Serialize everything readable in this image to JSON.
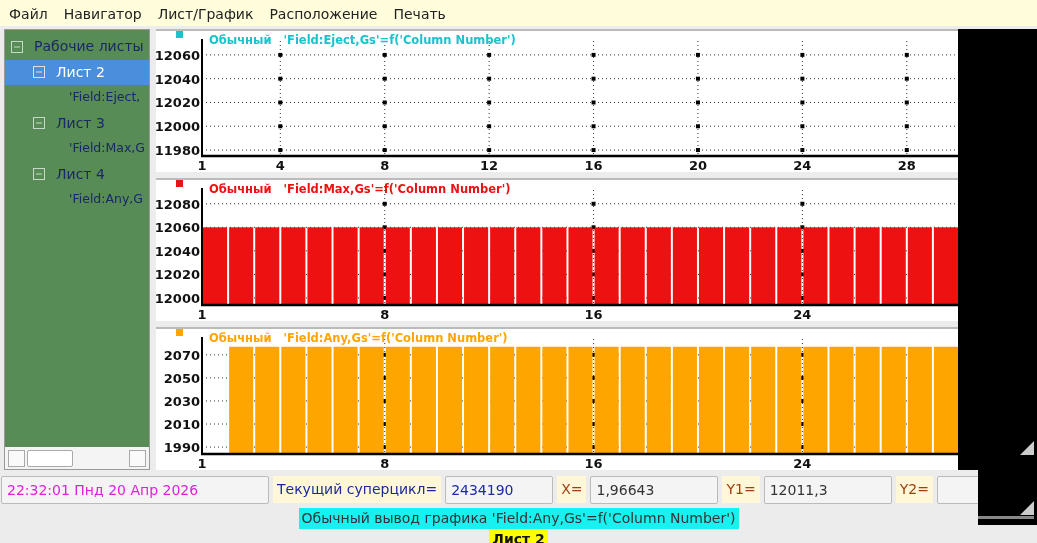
{
  "menu": [
    "Файл",
    "Навигатор",
    "Лист/График",
    "Расположение",
    "Печать"
  ],
  "tree": [
    {
      "label": "Рабочие листы",
      "expanded": true,
      "selected": false,
      "children": [
        {
          "label": "Лист 2",
          "expanded": true,
          "selected": true,
          "children": [
            {
              "label": "'Field:Eject,"
            }
          ]
        },
        {
          "label": "Лист 3",
          "expanded": true,
          "selected": false,
          "children": [
            {
              "label": "'Field:Max,G"
            }
          ]
        },
        {
          "label": "Лист 4",
          "expanded": true,
          "selected": false,
          "children": [
            {
              "label": "'Field:Any,G"
            }
          ]
        }
      ]
    }
  ],
  "charts": [
    {
      "color": "#17c4cc",
      "chart_data": {
        "type": "bar",
        "title": "Обычный   'Field:Eject,Gs'=f('Column Number')",
        "xlim": [
          1,
          30
        ],
        "ylim": [
          11975,
          12070
        ],
        "xticks": [
          1,
          4,
          8,
          12,
          16,
          20,
          24,
          28
        ],
        "yticks": [
          11980,
          12000,
          12020,
          12040,
          12060
        ],
        "grid": true
      }
    },
    {
      "color": "#ee1111",
      "chart_data": {
        "type": "bar",
        "title": "Обычный   'Field:Max,Gs'=f('Column Number')",
        "xlim": [
          1,
          30
        ],
        "ylim": [
          11994,
          12090
        ],
        "xticks": [
          1,
          8,
          16,
          24
        ],
        "yticks": [
          12000,
          12020,
          12040,
          12060,
          12080
        ],
        "grid": true,
        "x": [
          1.5,
          2.5,
          3.5,
          4.5,
          5.5,
          6.5,
          7.5,
          8.5,
          9.5,
          10.5,
          11.5,
          12.5,
          13.5,
          14.5,
          15.5,
          16.5,
          17.5,
          18.5,
          19.5,
          20.5,
          21.5,
          22.5,
          23.5,
          24.5,
          25.5,
          26.5,
          27.5,
          28.5,
          29.5
        ],
        "series": [
          {
            "color": "#ee1111",
            "values": [
              12060,
              12060,
              12060,
              12060,
              12060,
              12060,
              12060,
              12060,
              12060,
              12060,
              12060,
              12060,
              12060,
              12060,
              12060,
              12060,
              12060,
              12060,
              12060,
              12060,
              12060,
              12060,
              12060,
              12060,
              12060,
              12060,
              12060,
              12060,
              12060
            ]
          }
        ]
      }
    },
    {
      "color": "#ffa500",
      "chart_data": {
        "type": "bar",
        "title": "Обычный   'Field:Any,Gs'=f('Column Number')",
        "xlim": [
          1,
          30
        ],
        "ylim": [
          1984,
          2082
        ],
        "xticks": [
          1,
          8,
          16,
          24
        ],
        "yticks": [
          1990,
          2010,
          2030,
          2050,
          2070
        ],
        "grid": true,
        "x": [
          2.5,
          3.5,
          4.5,
          5.5,
          6.5,
          7.5,
          8.5,
          9.5,
          10.5,
          11.5,
          12.5,
          13.5,
          14.5,
          15.5,
          16.5,
          17.5,
          18.5,
          19.5,
          20.5,
          21.5,
          22.5,
          23.5,
          24.5,
          25.5,
          26.5,
          27.5,
          28.5,
          29.5
        ],
        "series": [
          {
            "color": "#ffa500",
            "values": [
              2077,
              2077,
              2077,
              2077,
              2077,
              2077,
              2077,
              2077,
              2077,
              2077,
              2077,
              2077,
              2077,
              2077,
              2077,
              2077,
              2077,
              2077,
              2077,
              2077,
              2077,
              2077,
              2077,
              2077,
              2077,
              2077,
              2077,
              2077
            ]
          }
        ]
      }
    }
  ],
  "status": {
    "datetime": "22:32:01 Пнд 20 Апр 2026",
    "supercycle_label": "Текущий суперцикл=",
    "supercycle_value": "2434190",
    "x_label": "X=",
    "x_value": "1,96643",
    "y1_label": "Y1=",
    "y1_value": "12011,3",
    "y2_label": "Y2="
  },
  "banner": "Обычный вывод графика 'Field:Any,Gs'=f('Column Number')",
  "sheet_label": "Лист 2"
}
